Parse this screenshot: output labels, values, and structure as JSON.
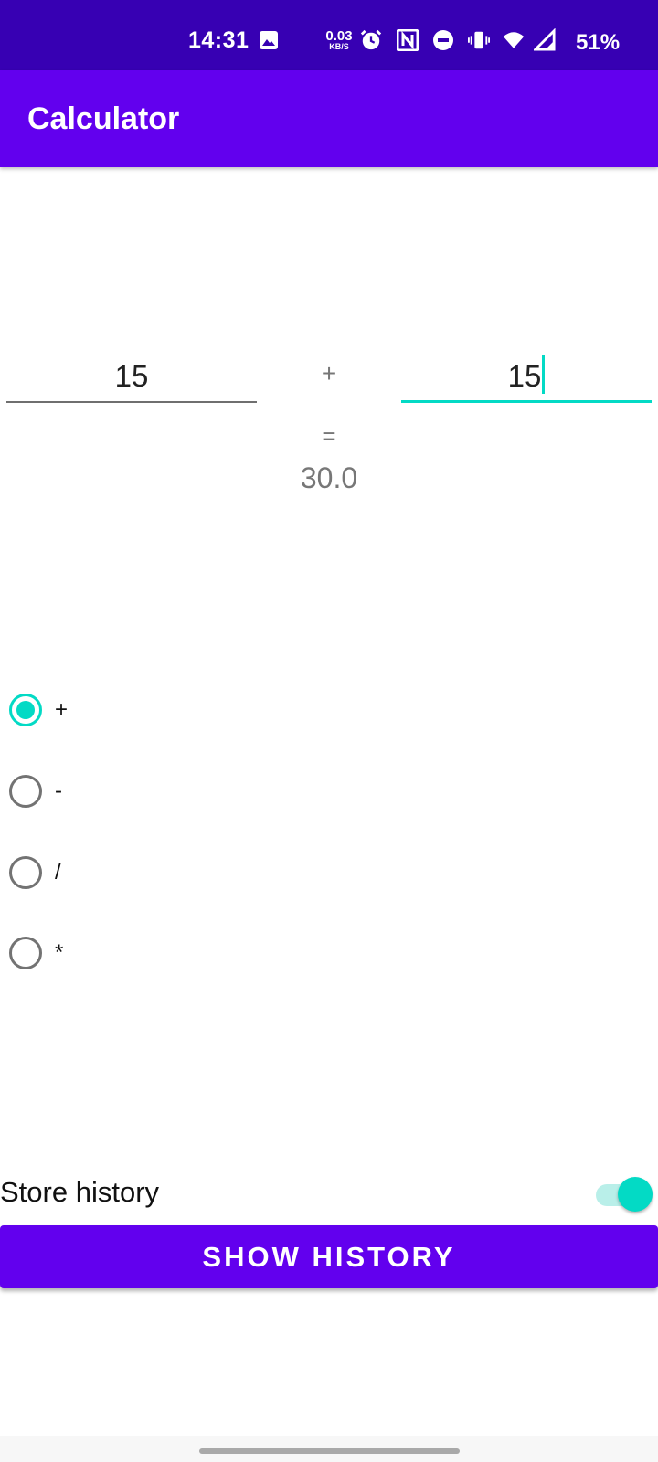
{
  "status_bar": {
    "time": "14:31",
    "speed_value": "0.03",
    "speed_unit": "KB/S",
    "battery": "51%",
    "icons": [
      "image-icon",
      "alarm-icon",
      "nfc-icon",
      "dnd-icon",
      "vibrate-icon",
      "wifi-icon",
      "signal-icon"
    ]
  },
  "app_bar": {
    "title": "Calculator"
  },
  "calculator": {
    "operand1": "15",
    "operand2": "15",
    "operator": "+",
    "equals": "=",
    "result": "30.0"
  },
  "operations": [
    {
      "label": "+",
      "checked": true
    },
    {
      "label": "-",
      "checked": false
    },
    {
      "label": "/",
      "checked": false
    },
    {
      "label": "*",
      "checked": false
    }
  ],
  "settings": {
    "store_history_label": "Store history",
    "store_history_on": true
  },
  "actions": {
    "show_history_label": "SHOW HISTORY"
  },
  "colors": {
    "status_bar": "#3700b3",
    "primary": "#6200ee",
    "accent": "#03dac5"
  }
}
